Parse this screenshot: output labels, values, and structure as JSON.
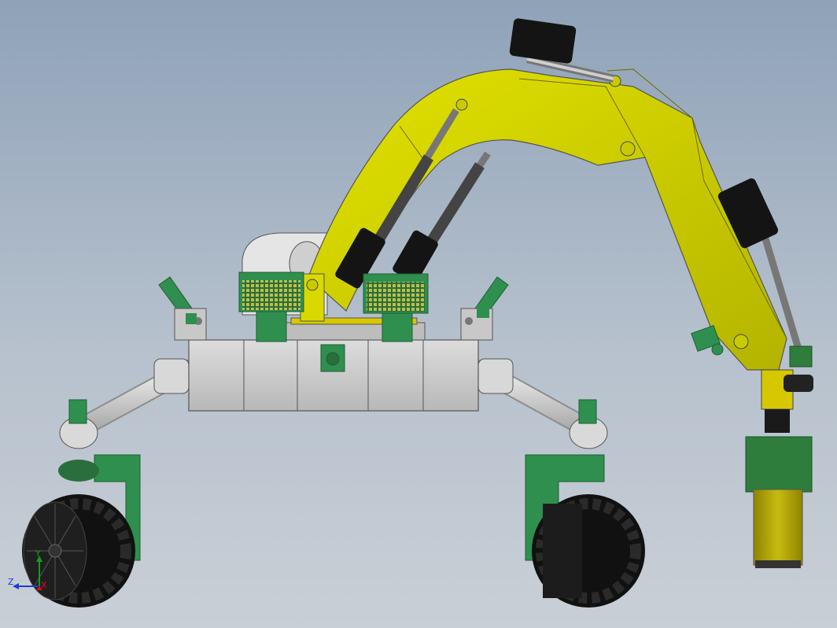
{
  "colors": {
    "background_top": "#8fa2b8",
    "background_bottom": "#c9cfd6",
    "arm_yellow": "#d9d900",
    "arm_yellow_dark": "#9a9a00",
    "body_gray": "#c8c8c8",
    "mount_green": "#2f8f4f",
    "mount_green_dark": "#1f5f33",
    "wheel_black": "#1a1a1a",
    "actuator_black": "#141414",
    "cylinder_gray": "#9a9a9a",
    "joint_gray": "#d4d4d4",
    "drill_green": "#2e7d3c",
    "drill_olive": "#b5a800",
    "axis_x": "#d11",
    "axis_y": "#1a9a1a",
    "axis_z": "#1a3fd1"
  },
  "axes": {
    "x_label": "X",
    "y_label": "Y",
    "z_label": "Z"
  }
}
